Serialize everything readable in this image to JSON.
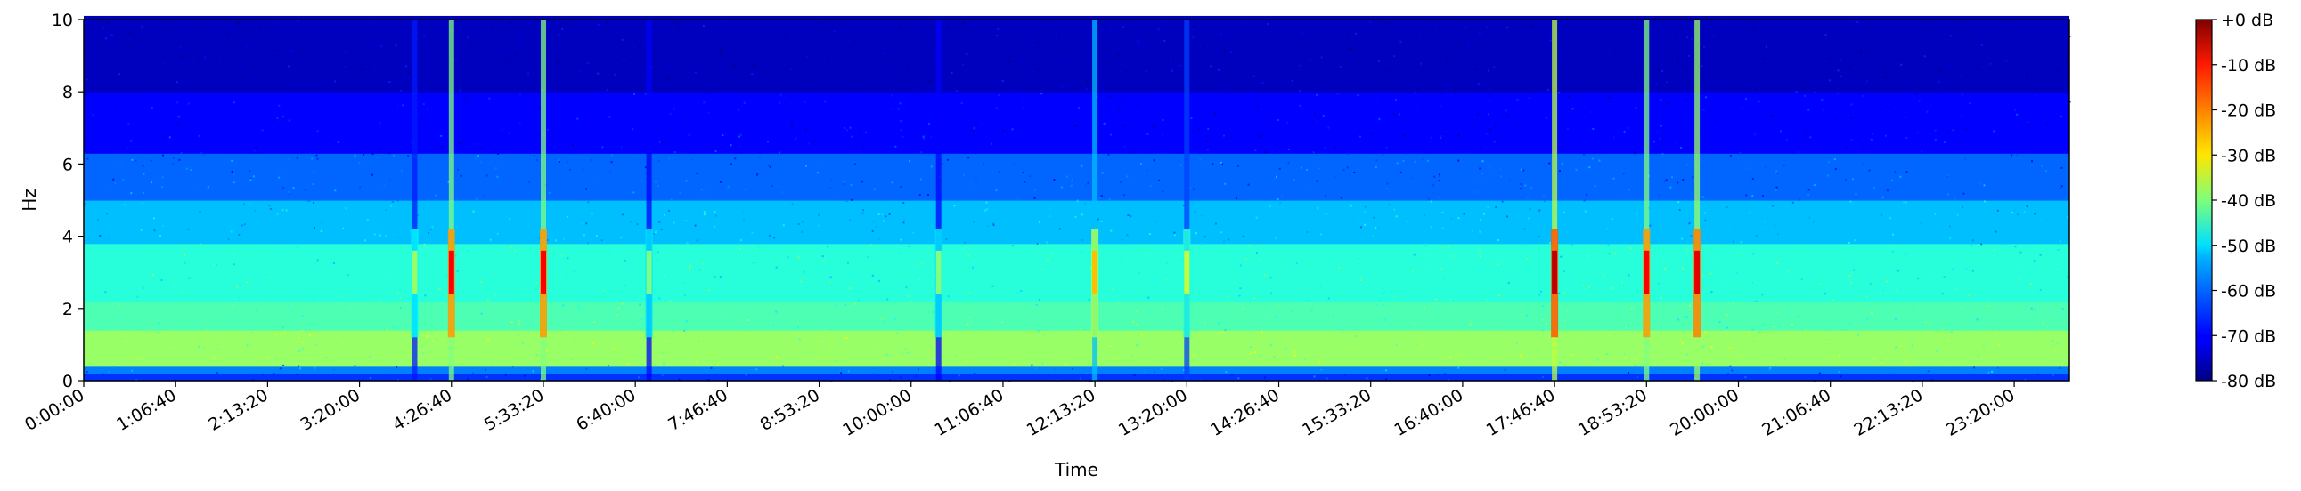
{
  "chart_data": {
    "type": "heatmap",
    "title": "",
    "xlabel": "Time",
    "ylabel": "Hz",
    "x_ticks": [
      "0:00:00",
      "1:06:40",
      "2:13:20",
      "3:20:00",
      "4:26:40",
      "5:33:20",
      "6:40:00",
      "7:46:40",
      "8:53:20",
      "10:00:00",
      "11:06:40",
      "12:13:20",
      "13:20:00",
      "14:26:40",
      "15:33:20",
      "16:40:00",
      "17:46:40",
      "18:53:20",
      "20:00:00",
      "21:06:40",
      "22:13:20",
      "23:20:00"
    ],
    "x_tick_seconds": [
      0,
      4000,
      8000,
      12000,
      16000,
      20000,
      24000,
      28000,
      32000,
      36000,
      40000,
      44000,
      48000,
      52000,
      56000,
      60000,
      64000,
      68000,
      72000,
      76000,
      80000,
      84000
    ],
    "xlim_seconds": [
      0,
      86400
    ],
    "y_ticks": [
      "0",
      "2",
      "4",
      "6",
      "8",
      "10"
    ],
    "y_tick_values": [
      0,
      2,
      4,
      6,
      8,
      10
    ],
    "ylim": [
      0,
      10
    ],
    "colorbar": {
      "ticks": [
        "+0 dB",
        "-10 dB",
        "-20 dB",
        "-30 dB",
        "-40 dB",
        "-50 dB",
        "-60 dB",
        "-70 dB",
        "-80 dB"
      ],
      "tick_values": [
        0,
        -10,
        -20,
        -30,
        -40,
        -50,
        -60,
        -70,
        -80
      ],
      "range": [
        -80,
        0
      ],
      "colormap": "jet"
    },
    "grid": false,
    "events": [
      {
        "time": "4:00:00",
        "peak_db": -38
      },
      {
        "time": "4:26:40",
        "peak_db": -10
      },
      {
        "time": "5:33:20",
        "peak_db": -10
      },
      {
        "time": "6:50:00",
        "peak_db": -40
      },
      {
        "time": "10:20:00",
        "peak_db": -40
      },
      {
        "time": "12:13:20",
        "peak_db": -25
      },
      {
        "time": "13:20:00",
        "peak_db": -35
      },
      {
        "time": "17:46:40",
        "peak_db": -5
      },
      {
        "time": "18:53:20",
        "peak_db": -10
      },
      {
        "time": "19:30:00",
        "peak_db": -8
      }
    ]
  }
}
